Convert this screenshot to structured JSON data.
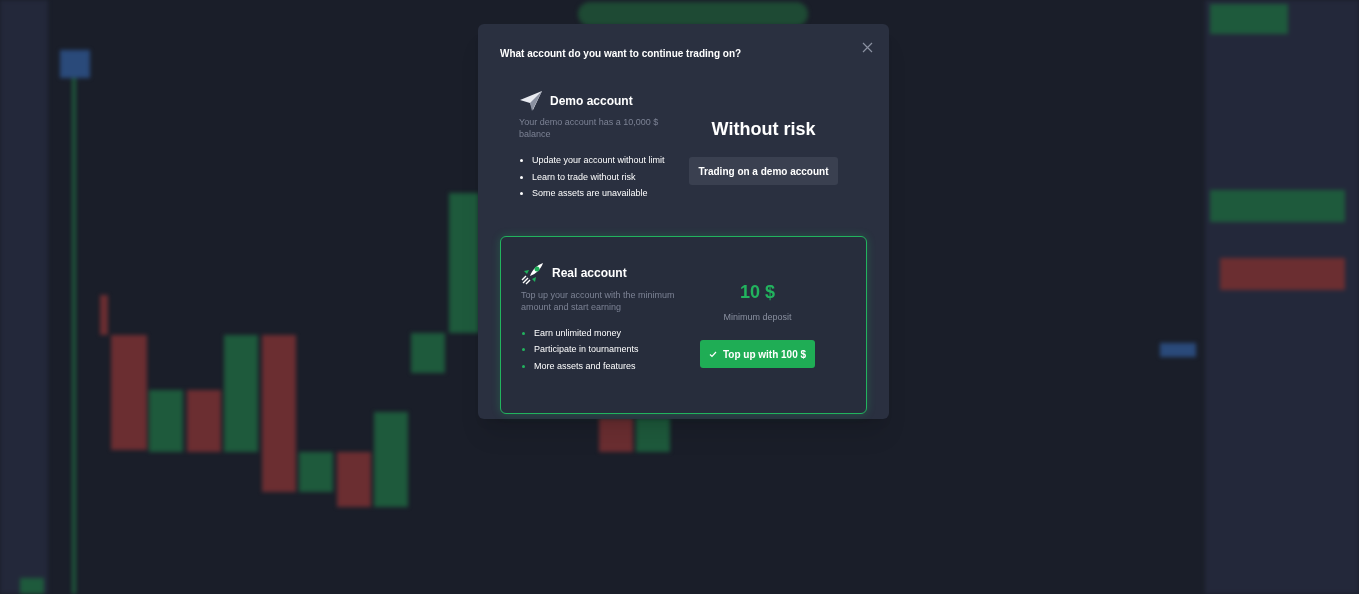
{
  "dialog": {
    "question": "What account do you want to continue trading on?",
    "accounts": [
      {
        "kind": "demo",
        "selected": false,
        "title": "Demo account",
        "description": "Your demo account has a 10,000 $ balance",
        "features": [
          "Update your account without limit",
          "Learn to trade without risk",
          "Some assets are unavailable"
        ],
        "headline": "Without risk",
        "button": "Trading on a demo account"
      },
      {
        "kind": "real",
        "selected": true,
        "title": "Real account",
        "description": "Top up your account with the minimum amount and start earning",
        "features": [
          "Earn unlimited money",
          "Participate in tournaments",
          "More assets and features"
        ],
        "amount": "10 $",
        "amount_caption": "Minimum deposit",
        "button": "Top up with 100 $"
      }
    ]
  }
}
